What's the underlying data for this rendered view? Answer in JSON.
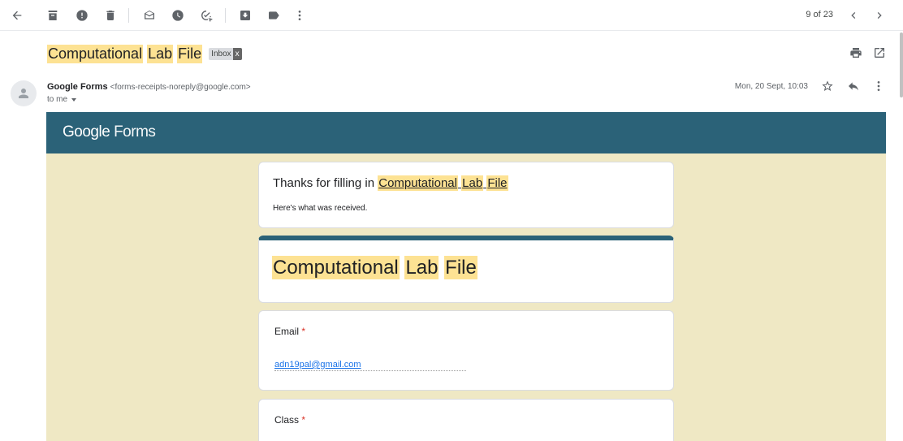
{
  "toolbar": {
    "page_count": "9 of 23",
    "icons": [
      "back-arrow-icon",
      "archive-icon",
      "report-spam-icon",
      "delete-icon",
      "mark-unread-icon",
      "snooze-icon",
      "add-to-tasks-icon",
      "move-to-icon",
      "label-icon",
      "more-icon",
      "chevron-left-icon",
      "chevron-right-icon"
    ]
  },
  "email": {
    "subject_parts": [
      "Computational",
      "Lab",
      "File"
    ],
    "label": "Inbox",
    "label_close": "x",
    "sender_name": "Google Forms",
    "sender_email": "<forms-receipts-noreply@google.com>",
    "to": "to me",
    "date": "Mon, 20 Sept, 10:03"
  },
  "forms": {
    "logo_google": "Google",
    "logo_forms": "Forms",
    "header_color": "#2b6278",
    "background_color": "#efe8c4",
    "thanks_prefix": "Thanks for filling in",
    "form_title_parts": [
      "Computational",
      "Lab",
      "File"
    ],
    "received": "Here's what was received.",
    "questions": [
      {
        "label": "Email",
        "required": "*",
        "answer": "adn19pal@gmail.com"
      },
      {
        "label": "Class",
        "required": "*",
        "answer": ""
      }
    ]
  },
  "colors": {
    "highlight": "#fde293",
    "required": "#d93025",
    "link": "#1a73e8"
  }
}
